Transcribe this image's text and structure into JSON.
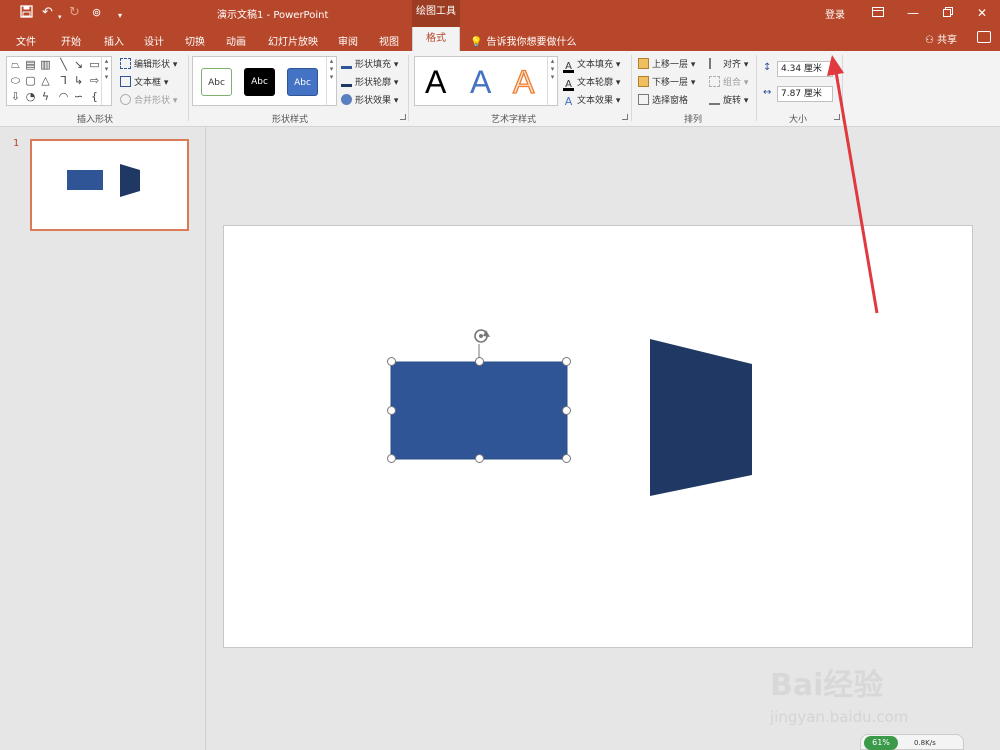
{
  "app": {
    "doc_title": "演示文稿1  -  PowerPoint",
    "context_tab_group": "绘图工具",
    "login": "登录",
    "share": "共享"
  },
  "tabs": [
    "文件",
    "开始",
    "插入",
    "设计",
    "切换",
    "动画",
    "幻灯片放映",
    "审阅",
    "视图"
  ],
  "active_tab": "格式",
  "tell_me": "告诉我你想要做什么",
  "ribbon": {
    "insert_shapes": {
      "label": "插入形状",
      "edit_shape": "编辑形状",
      "text_box": "文本框",
      "merge_shapes": "合并形状"
    },
    "shape_styles": {
      "label": "形状样式",
      "preset_text": "Abc",
      "fill": "形状填充",
      "outline": "形状轮廓",
      "effects": "形状效果"
    },
    "wordart_styles": {
      "label": "艺术字样式",
      "glyph": "A",
      "text_fill": "文本填充",
      "text_outline": "文本轮廓",
      "text_effects": "文本效果"
    },
    "arrange": {
      "label": "排列",
      "bring_forward": "上移一层",
      "send_backward": "下移一层",
      "selection_pane": "选择窗格",
      "align": "对齐",
      "group": "组合",
      "rotate": "旋转"
    },
    "size": {
      "label": "大小",
      "height": "4.34 厘米",
      "width": "7.87 厘米"
    }
  },
  "thumbnail": {
    "number": "1"
  },
  "watermark": {
    "logo": "Bai经验",
    "url": "jingyan.baidu.com"
  },
  "tray": {
    "percent": "61%",
    "speed": "0.8K/s"
  },
  "colors": {
    "accent": "#b7472a",
    "rectangle": "#2f5597",
    "trapezoid": "#203864",
    "arrow": "#e0393e"
  }
}
